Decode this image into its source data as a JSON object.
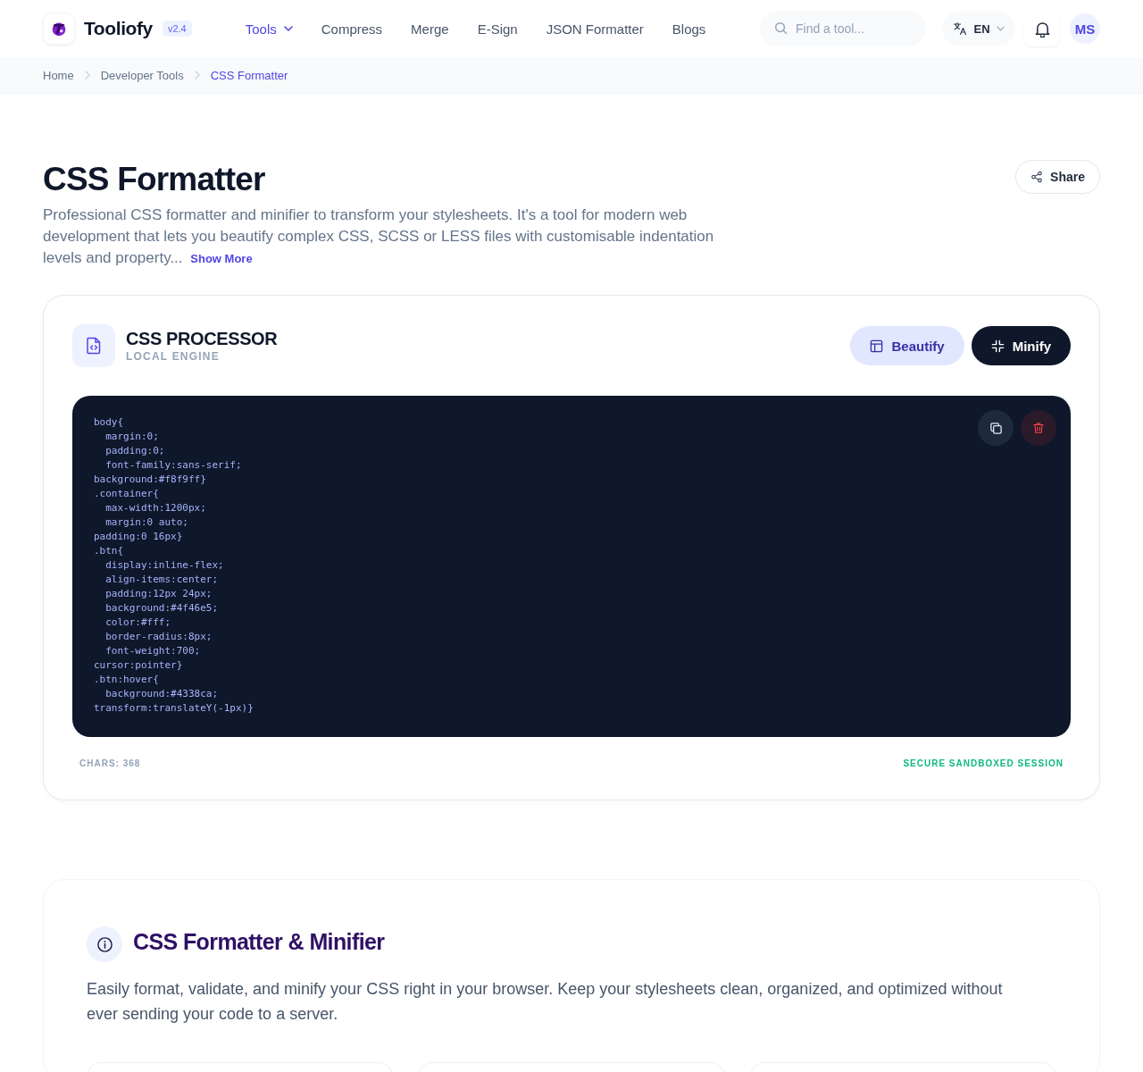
{
  "header": {
    "brand": {
      "name": "Tooliofy",
      "version": "v2.4"
    },
    "nav": [
      {
        "label": "Tools",
        "selected": true,
        "has_menu": true
      },
      {
        "label": "Compress",
        "selected": false,
        "has_menu": false
      },
      {
        "label": "Merge",
        "selected": false,
        "has_menu": false
      },
      {
        "label": "E-Sign",
        "selected": false,
        "has_menu": false
      },
      {
        "label": "JSON Formatter",
        "selected": false,
        "has_menu": false
      },
      {
        "label": "Blogs",
        "selected": false,
        "has_menu": false
      }
    ],
    "search": {
      "placeholder": "Find a tool..."
    },
    "language": {
      "code": "EN"
    },
    "user": {
      "initials": "MS"
    }
  },
  "breadcrumb": [
    {
      "label": "Home",
      "current": false
    },
    {
      "label": "Developer Tools",
      "current": false
    },
    {
      "label": "CSS Formatter",
      "current": true
    }
  ],
  "page": {
    "title": "CSS Formatter",
    "description": "Professional CSS formatter and minifier to transform your stylesheets. It's a tool for modern web development that lets you beautify complex CSS, SCSS or LESS files with customisable indentation levels and property...",
    "show_more": "Show More",
    "share": "Share"
  },
  "processor": {
    "title": "CSS PROCESSOR",
    "subtitle": "LOCAL ENGINE",
    "modes": [
      {
        "kind": "beautify",
        "label": "Beautify",
        "selected": false
      },
      {
        "kind": "minify",
        "label": "Minify",
        "selected": true
      }
    ],
    "code": "body{\n  margin:0;\n  padding:0;\n  font-family:sans-serif;\nbackground:#f8f9ff}\n.container{\n  max-width:1200px;\n  margin:0 auto;\npadding:0 16px}\n.btn{\n  display:inline-flex;\n  align-items:center;\n  padding:12px 24px;\n  background:#4f46e5;\n  color:#fff;\n  border-radius:8px;\n  font-weight:700;\ncursor:pointer}\n.btn:hover{\n  background:#4338ca;\ntransform:translateY(-1px)}",
    "chars": "CHARS: 368",
    "session": "SECURE SANDBOXED SESSION"
  },
  "about": {
    "title": "CSS Formatter & Minifier",
    "text": "Easily format, validate, and minify your CSS right in your browser. Keep your stylesheets clean, organized, and optimized without ever sending your code to a server."
  }
}
